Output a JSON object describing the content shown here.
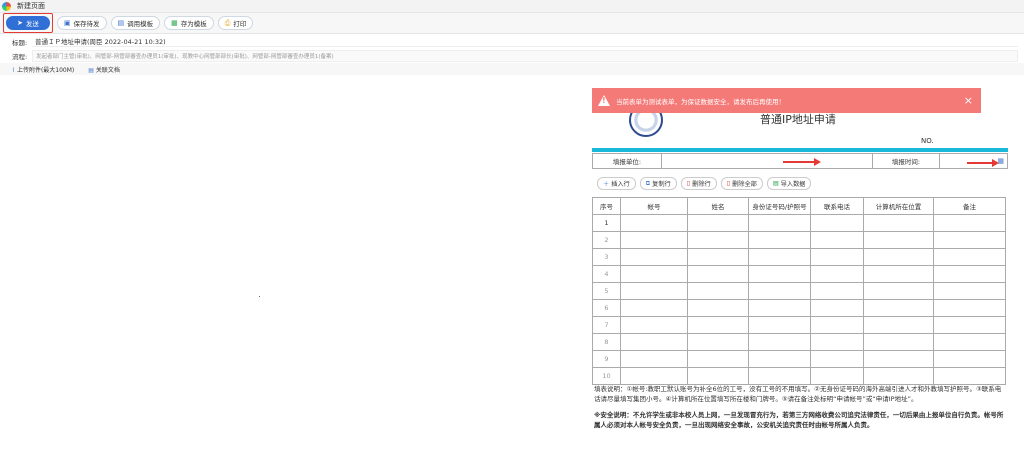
{
  "window": {
    "title": "新建页面"
  },
  "toolbar": {
    "send": "发送",
    "save_draft": "保存待发",
    "use_template": "调用模板",
    "save_template": "存为模板",
    "print": "打印"
  },
  "subject": {
    "label": "标题:",
    "value": "普通ＩＰ地址申请(周臣 2022-04-21 10:32)"
  },
  "process": {
    "label": "流程:",
    "value": "发起者部门主管(审批)、网管部-网管部審查办理员1(审批)、现教中心网管部部长(审批)、网管部-网管部審查办理员1(备案)"
  },
  "attachments": {
    "upload": "上传附件(最大100M)",
    "related": "关联文档"
  },
  "alert": {
    "text": "当前表单为测试表单，为保证数据安全，请发布后再使用！",
    "close": "×"
  },
  "form": {
    "title": "普通IP地址申请",
    "no_label": "NO.",
    "unit_label": "填报单位:",
    "unit_value": "",
    "time_label": "填报时间:",
    "time_value": ""
  },
  "actions": {
    "insert_row": "插入行",
    "copy_row": "复制行",
    "delete_row": "删除行",
    "delete_all": "删除全部",
    "import_data": "导入数据"
  },
  "table": {
    "headers": [
      "序号",
      "帐号",
      "姓名",
      "身份证号码/护照号",
      "联系电话",
      "计算机所在位置",
      "备注"
    ],
    "rows": [
      "1",
      "2",
      "3",
      "4",
      "5",
      "6",
      "7",
      "8",
      "9",
      "10"
    ]
  },
  "notes": {
    "fill": "填表说明：①帐号:教职工默认账号为补全6位的工号，没有工号的不用填写。②无身份证号码的海外高端引进人才和外教填写护照号。③联系电话请尽量填写集团小号。④计算机所在位置填写所在楼和门牌号。⑤请在备注处标明“申请帐号”或“申请IP地址”。",
    "security": "※安全说明：不允许学生或非本校人员上网，一旦发现冒充行为，若第三方网络收费公司追究法律责任，一切后果由上报单位自行负责。帐号所属人必须对本人帐号安全负责，一旦出现网络安全事故，公安机关追究责任时由帐号所属人负责。"
  },
  "colors": {
    "accent": "#2f6fd6",
    "alert_bg": "#f47a78",
    "header_bar": "#19b8d8",
    "arrow": "#e53935"
  }
}
